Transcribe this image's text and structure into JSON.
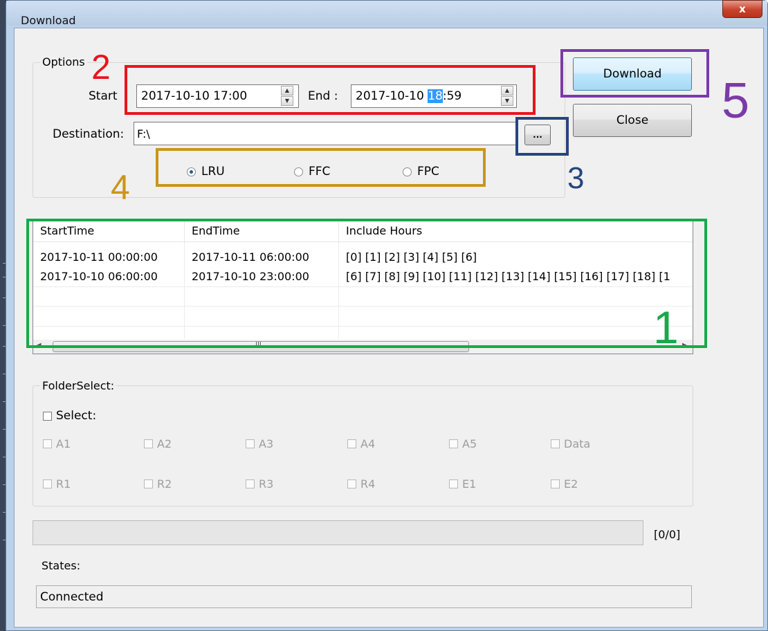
{
  "window": {
    "title": "Download",
    "close_glyph": "x"
  },
  "options": {
    "legend": "Options",
    "start_label": "Start",
    "start_value": "2017-10-10 17:00",
    "end_label": "End :",
    "end_value_pre": "2017-10-10 ",
    "end_value_sel": "18",
    "end_value_post": ":59",
    "destination_label": "Destination:",
    "destination_value": "F:\\",
    "browse_label": "...",
    "radio": [
      {
        "label": "LRU",
        "checked": true
      },
      {
        "label": "FFC",
        "checked": false
      },
      {
        "label": "FPC",
        "checked": false
      }
    ]
  },
  "buttons": {
    "download": "Download",
    "close": "Close"
  },
  "list": {
    "columns": [
      "StartTime",
      "EndTime",
      "Include Hours"
    ],
    "rows": [
      [
        "2017-10-11 00:00:00",
        "2017-10-11 06:00:00",
        "[0] [1] [2] [3] [4] [5] [6]"
      ],
      [
        "2017-10-10 06:00:00",
        "2017-10-10 23:00:00",
        "[6] [7] [8] [9] [10] [11] [12] [13] [14] [15] [16] [17] [18] [1"
      ]
    ],
    "scroll_thumb_glyph": "III"
  },
  "folder_select": {
    "legend": "FolderSelect:",
    "select_label": "Select:",
    "row1": [
      "A1",
      "A2",
      "A3",
      "A4",
      "A5",
      "Data"
    ],
    "row2": [
      "R1",
      "R2",
      "R3",
      "R4",
      "E1",
      "E2"
    ]
  },
  "progress": {
    "counter": "[0/0]",
    "fraction": 0
  },
  "states": {
    "label": "States:",
    "value": "Connected"
  },
  "annotations": {
    "n1": "1",
    "n2": "2",
    "n3": "3",
    "n4": "4",
    "n5": "5",
    "colors": {
      "n1": "#1aa84a",
      "n2": "#e8141c",
      "n3": "#27457e",
      "n4": "#c9961a",
      "n5": "#7b3aa8"
    }
  },
  "icons": {
    "spin_up": "up-triangle",
    "spin_down": "down-triangle",
    "scroll_left": "left-triangle",
    "scroll_right": "right-triangle"
  }
}
